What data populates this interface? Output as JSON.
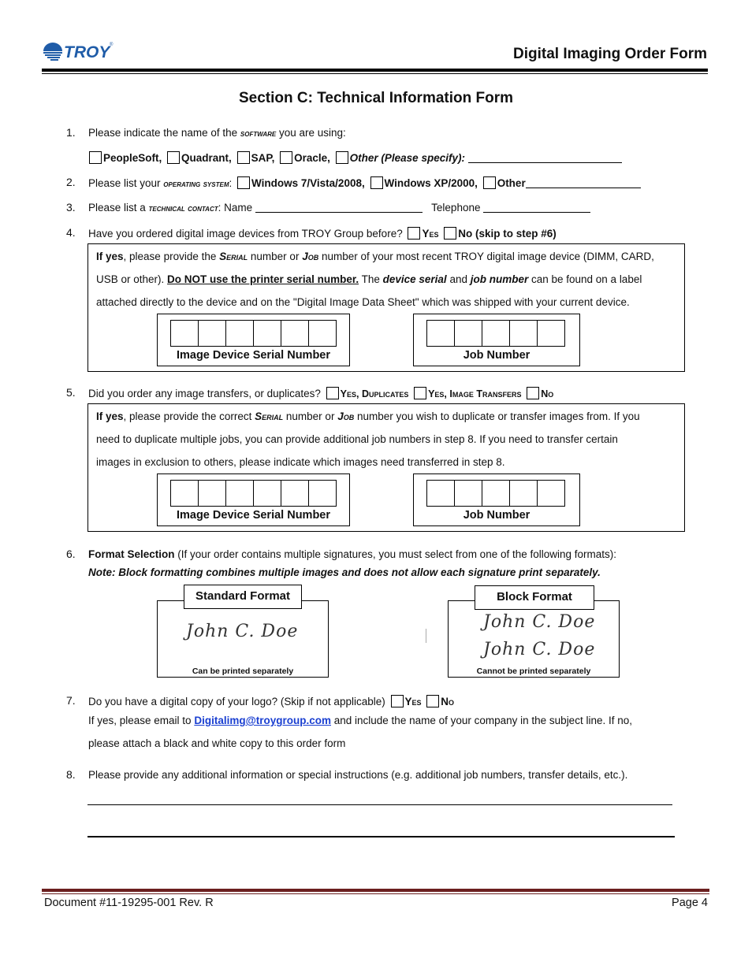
{
  "header": {
    "logo_text": "TROY",
    "logo_reg": "®",
    "title": "Digital Imaging Order Form"
  },
  "section_title": "Section C: Technical Information Form",
  "q1": {
    "number": "1.",
    "prefix": "Please indicate the name of the ",
    "keyword": "software",
    "suffix": " you are using:",
    "options": [
      "PeopleSoft,",
      "Quadrant,",
      "SAP,",
      "Oracle,"
    ],
    "other_label": "Other (Please specify):"
  },
  "q2": {
    "number": "2.",
    "prefix": "Please list  your ",
    "keyword": "operating system",
    "suffix": ":",
    "options": [
      "Windows 7/Vista/2008,",
      "Windows XP/2000,",
      "Other"
    ]
  },
  "q3": {
    "number": "3.",
    "prefix": "Please list a ",
    "keyword": "technical contact",
    "suffix": ":  Name",
    "telephone_label": "Telephone"
  },
  "q4": {
    "number": "4.",
    "text": "Have you ordered digital image devices from TROY Group before?",
    "yes_label": "Yes",
    "no_label": "No (skip to step #6)",
    "box": {
      "line1_bold": "If yes",
      "line1_a": ", please provide the ",
      "serial": "Serial",
      "line1_b": " number or ",
      "job": "Job",
      "line1_c": " number of your most recent TROY digital image device (DIMM, CARD,",
      "line2_a": "USB or other).  ",
      "line2_underline": "Do NOT use the printer serial number.",
      "line2_b": "  The ",
      "line2_device_serial": "device serial",
      "line2_c": " and ",
      "line2_job_number": "job number",
      "line2_d": " can be found on a label",
      "line3": "attached directly to the device and on the \"Digital Image Data Sheet\" which was shipped with your current device."
    },
    "serial_label": "Image Device Serial Number",
    "job_label": "Job Number"
  },
  "q5": {
    "number": "5.",
    "text": "Did you order any image transfers, or duplicates?",
    "options": [
      "Yes, Duplicates",
      "Yes, Image Transfers",
      "No"
    ],
    "box": {
      "line1_bold": "If yes",
      "line1_a": ", please provide the correct ",
      "serial": "Serial",
      "line1_b": " number or ",
      "job": "Job",
      "line1_c": " number you wish to duplicate or transfer images from. If you",
      "line2": "need to duplicate multiple jobs, you can provide additional job numbers in step 8. If you need to transfer certain",
      "line3": "images in exclusion to others, please indicate which images need transferred in step 8."
    },
    "serial_label": "Image Device Serial Number",
    "job_label": "Job Number"
  },
  "q6": {
    "number": "6.",
    "bold": "Format Selection",
    "text": " (If your order contains multiple signatures, you must select from one of the following formats):",
    "note": "Note: Block formatting combines multiple images and does not allow each signature print separately.",
    "standard": {
      "title": "Standard Format",
      "signature": "John C. Doe",
      "caption": "Can be printed separately"
    },
    "block": {
      "title": "Block Format",
      "signatures": [
        "John C. Doe",
        "John C. Doe"
      ],
      "caption": "Cannot be printed separately"
    }
  },
  "q7": {
    "number": "7.",
    "text": " Do you have a digital copy of your logo? (Skip if not applicable)",
    "yes_label": "Yes",
    "no_label": "No",
    "line2_a": "If yes, please email to ",
    "email": "Digitalimg@troygroup.com",
    "line2_b": " and include the name of your company in the subject line.  If no,",
    "line3": "please attach a black and white copy to this order form"
  },
  "q8": {
    "number": "8.",
    "text": "Please provide any additional information or special instructions (e.g. additional job numbers, transfer details, etc.)."
  },
  "footer": {
    "document": "Document #11-19295-001 Rev. R",
    "page": "Page 4"
  }
}
